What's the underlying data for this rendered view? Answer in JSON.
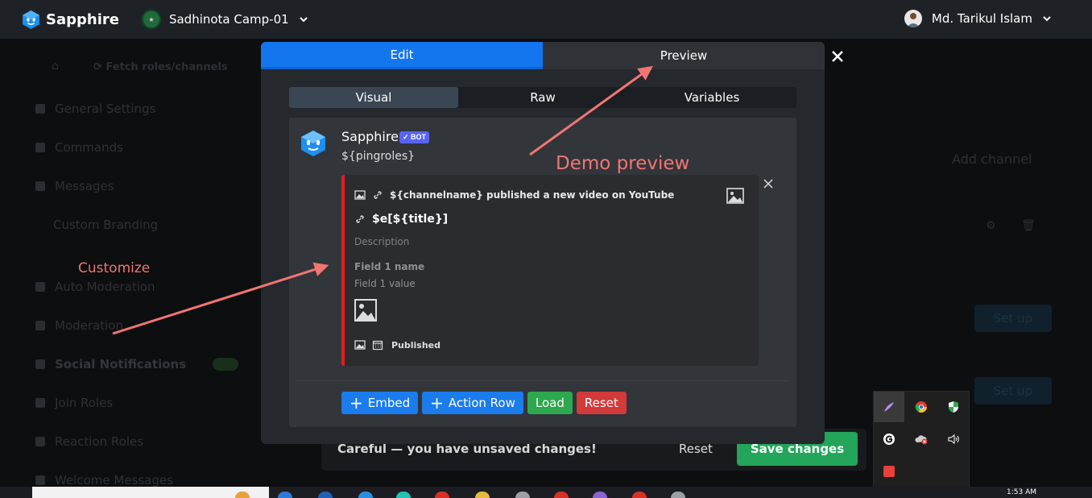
{
  "app": {
    "name": "Sapphire"
  },
  "header": {
    "server_name": "Sadhinota Camp-01",
    "user_name": "Md. Tarikul Islam"
  },
  "background": {
    "toolbar_label": "Fetch roles/channels",
    "sidebar_items": [
      "General Settings",
      "Commands",
      "Messages",
      "Custom Branding",
      "Auto Moderation",
      "Moderation",
      "Social Notifications",
      "Join Roles",
      "Reaction Roles",
      "Welcome Messages"
    ],
    "add_channel_label": "Add channel",
    "setup_label": "Set up"
  },
  "unsaved_bar": {
    "message": "Careful — you have unsaved changes!",
    "reset_label": "Reset",
    "save_label": "Save changes"
  },
  "modal": {
    "tabs": [
      "Edit",
      "Preview"
    ],
    "subtabs": [
      "Visual",
      "Raw",
      "Variables"
    ],
    "bot_name": "Sapphire",
    "bot_badge": "✓ BOT",
    "message_content": "${pingroles}",
    "embed": {
      "author": "${channelname} published a new video on YouTube",
      "title": "$e[${title}]",
      "description": "Description",
      "field_name": "Field 1 name",
      "field_value": "Field 1 value",
      "footer": "Published",
      "color": "#e81a1a"
    },
    "buttons": {
      "embed": "Embed",
      "action_row": "Action Row",
      "load": "Load",
      "reset": "Reset"
    }
  },
  "annotations": {
    "demo_preview": "Demo preview",
    "customize": "Customize",
    "color": "#f07672"
  },
  "taskbar": {
    "time": "1:53 AM"
  }
}
